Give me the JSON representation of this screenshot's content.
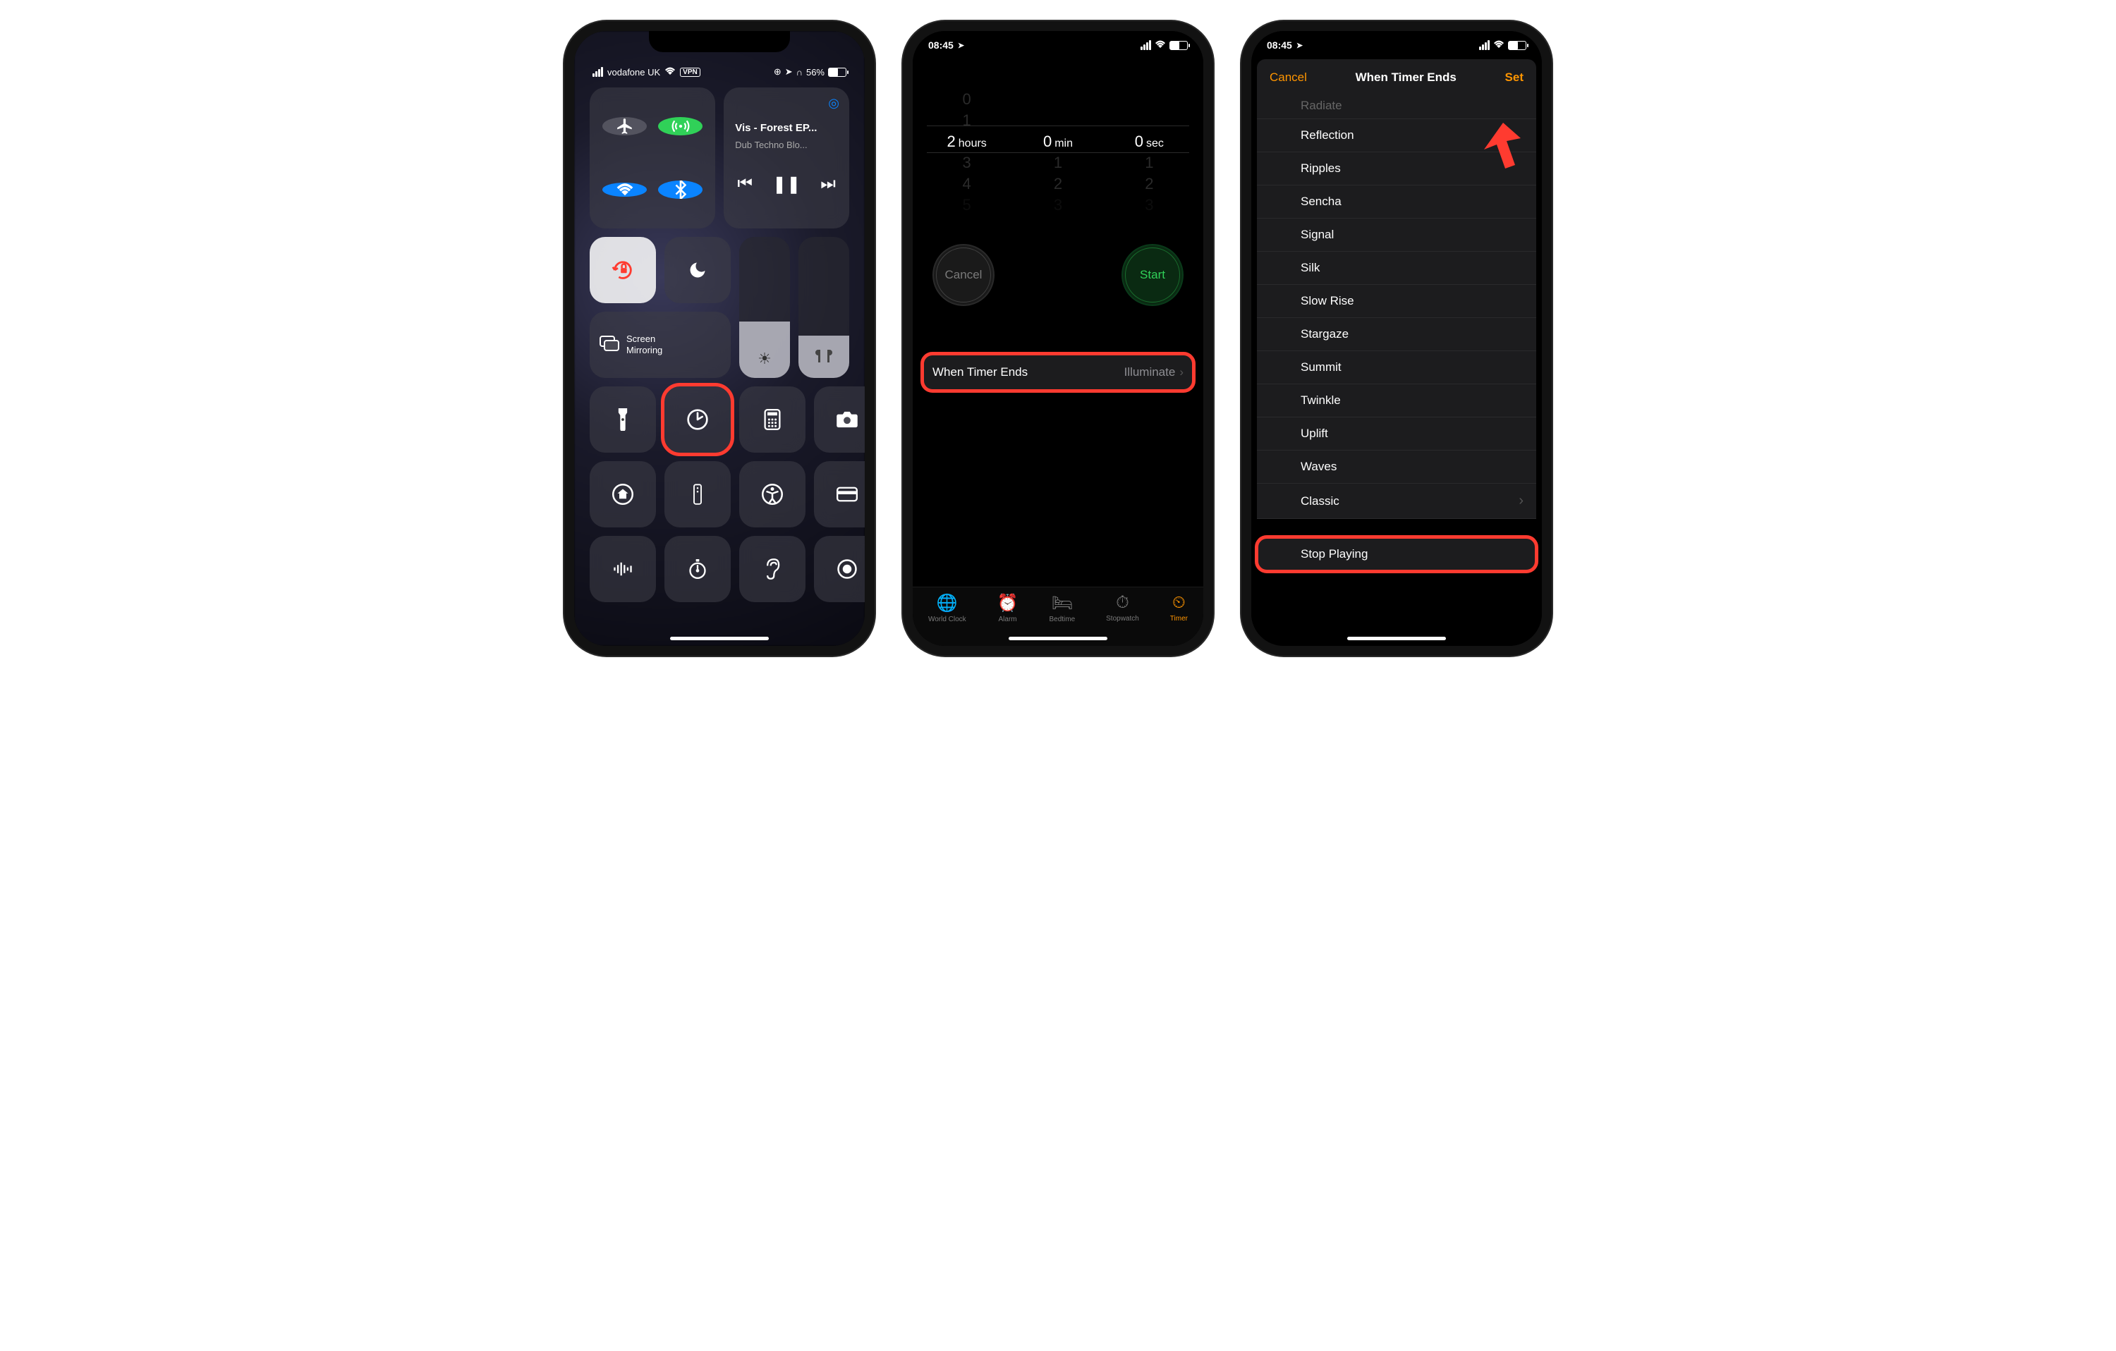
{
  "screen1": {
    "status": {
      "carrier": "vodafone UK",
      "vpn": "VPN",
      "battery_pct": "56%"
    },
    "media": {
      "title": "Vis - Forest EP...",
      "subtitle": "Dub Techno Blo..."
    },
    "screen_mirroring": "Screen\nMirroring",
    "brightness_fill_pct": 40,
    "volume_fill_pct": 30
  },
  "screen2": {
    "status_time": "08:45",
    "picker": {
      "hours_above": [
        "0",
        "1"
      ],
      "hours_sel": "2",
      "hours_unit": "hours",
      "hours_below": [
        "3",
        "4",
        "5"
      ],
      "min_above": [
        "",
        " "
      ],
      "min_sel": "0",
      "min_unit": "min",
      "min_below": [
        "1",
        "2",
        "3"
      ],
      "sec_above": [
        "",
        " "
      ],
      "sec_sel": "0",
      "sec_unit": "sec",
      "sec_below": [
        "1",
        "2",
        "3"
      ]
    },
    "cancel": "Cancel",
    "start": "Start",
    "when_ends_label": "When Timer Ends",
    "when_ends_value": "Illuminate",
    "tabs": {
      "world_clock": "World Clock",
      "alarm": "Alarm",
      "bedtime": "Bedtime",
      "stopwatch": "Stopwatch",
      "timer": "Timer"
    }
  },
  "screen3": {
    "status_time": "08:45",
    "cancel": "Cancel",
    "title": "When Timer Ends",
    "set": "Set",
    "sounds_top_faded": "Radiate",
    "sounds": [
      "Reflection",
      "Ripples",
      "Sencha",
      "Signal",
      "Silk",
      "Slow Rise",
      "Stargaze",
      "Summit",
      "Twinkle",
      "Uplift",
      "Waves"
    ],
    "classic": "Classic",
    "stop_playing": "Stop Playing"
  }
}
